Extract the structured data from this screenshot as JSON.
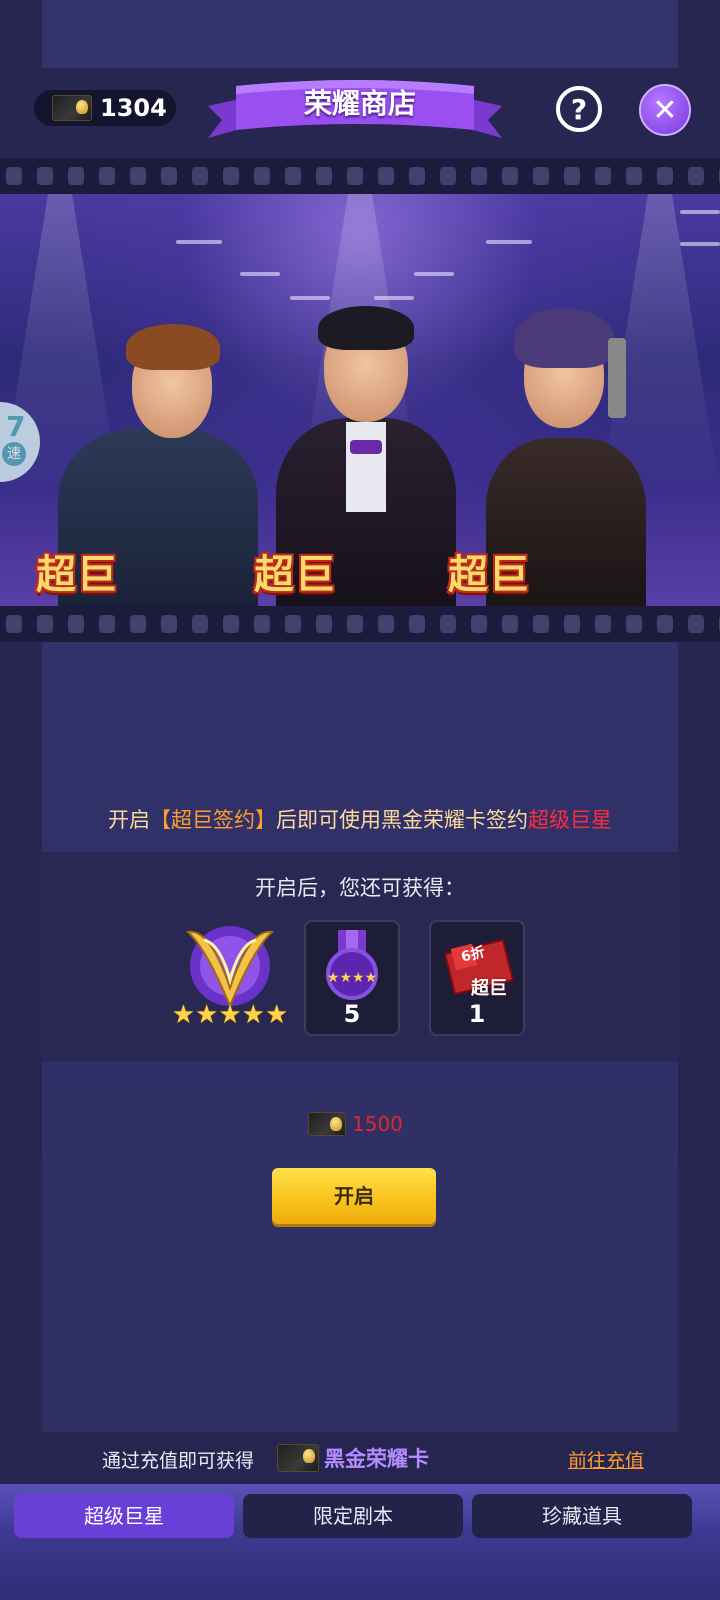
{
  "header": {
    "balance": "1304",
    "title": "荣耀商店",
    "help_label": "?",
    "close_label": "✕"
  },
  "banner": {
    "tags": [
      "超巨",
      "超巨",
      "超巨"
    ],
    "side_badge_num": "7",
    "side_badge_label": "速"
  },
  "notice": {
    "part1": "开启",
    "highlight": "【超巨签约】",
    "part2": "后即可使用黑金荣耀卡签约",
    "red": "超级巨星"
  },
  "rewards": {
    "title": "开启后，您还可获得：",
    "items": [
      {
        "name": "emblem",
        "count": ""
      },
      {
        "name": "star-medal",
        "count": "5"
      },
      {
        "name": "discount-ticket",
        "count": "1",
        "ticket_top": "6折",
        "ticket_bottom": "超巨"
      }
    ]
  },
  "purchase": {
    "price": "1500",
    "open_label": "开启"
  },
  "promo": {
    "text": "通过充值即可获得",
    "card_name": "黑金荣耀卡",
    "link": "前往充值"
  },
  "tabs": [
    {
      "label": "超级巨星",
      "active": true
    },
    {
      "label": "限定剧本",
      "active": false
    },
    {
      "label": "珍藏道具",
      "active": false
    }
  ],
  "colors": {
    "accent_purple": "#6a3fd8",
    "gold": "#f7c21a",
    "price_red": "#e0262c",
    "link_orange": "#ff9c2a"
  }
}
